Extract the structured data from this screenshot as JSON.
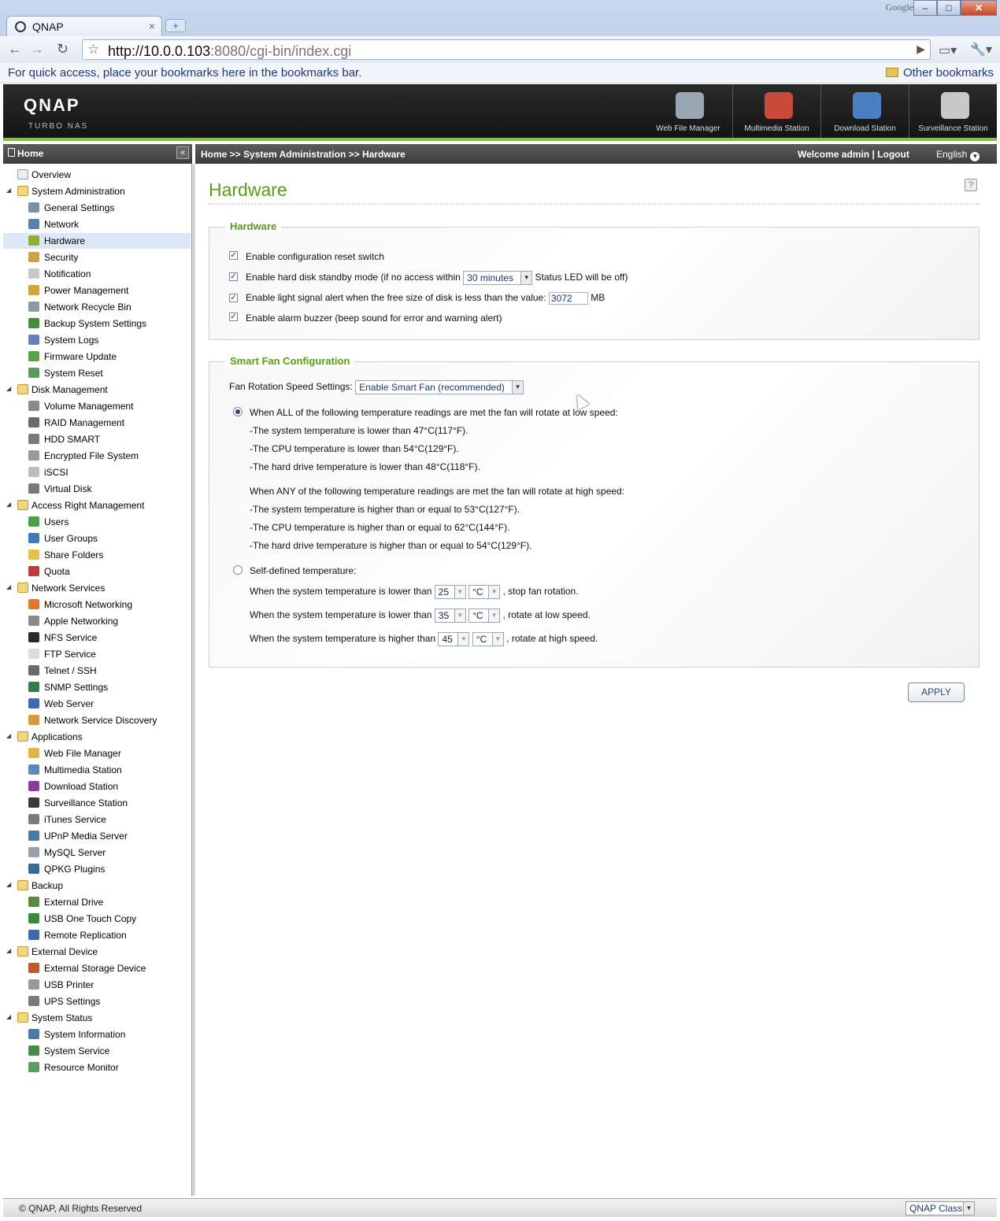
{
  "browser": {
    "tab_title": "QNAP",
    "tab_close": "×",
    "new_tab": "+",
    "url_host": "http://10.0.0.103",
    "url_rest": ":8080/cgi-bin/index.cgi",
    "google_label": "Google",
    "bookmarks_message": "For quick access, place your bookmarks here in the bookmarks bar.",
    "other_bookmarks": "Other bookmarks"
  },
  "header": {
    "brand": "QNAP",
    "brand_sub": "TURBO NAS",
    "apps": [
      {
        "label": "Web File Manager",
        "color": "#9aa7b3"
      },
      {
        "label": "Multimedia Station",
        "color": "#c94a3a"
      },
      {
        "label": "Download Station",
        "color": "#4a7fc1"
      },
      {
        "label": "Surveillance Station",
        "color": "#c8c8c8"
      }
    ]
  },
  "nav": {
    "home": "Home",
    "collapse": "«",
    "breadcrumb": "Home >> System Administration >> Hardware",
    "welcome": "Welcome admin | Logout",
    "language": "English"
  },
  "sidebar": {
    "items": [
      {
        "label": "Overview",
        "kind": "top",
        "icon": "overview-icon",
        "color": "#e8eef4"
      },
      {
        "label": "System Administration",
        "kind": "cat"
      },
      {
        "label": "General Settings",
        "kind": "sub",
        "icon": "general-settings-icon",
        "color": "#7c8fa3"
      },
      {
        "label": "Network",
        "kind": "sub",
        "icon": "network-icon",
        "color": "#5a7fa8"
      },
      {
        "label": "Hardware",
        "kind": "sub",
        "icon": "hardware-icon",
        "color": "#8fae2c",
        "active": true
      },
      {
        "label": "Security",
        "kind": "sub",
        "icon": "security-icon",
        "color": "#c9a34a"
      },
      {
        "label": "Notification",
        "kind": "sub",
        "icon": "notification-icon",
        "color": "#c7c7c7"
      },
      {
        "label": "Power Management",
        "kind": "sub",
        "icon": "power-icon",
        "color": "#d2a53a"
      },
      {
        "label": "Network Recycle Bin",
        "kind": "sub",
        "icon": "recycle-bin-icon",
        "color": "#8b9aa8"
      },
      {
        "label": "Backup System Settings",
        "kind": "sub",
        "icon": "backup-settings-icon",
        "color": "#4a8a3a"
      },
      {
        "label": "System Logs",
        "kind": "sub",
        "icon": "logs-icon",
        "color": "#6a7fb8"
      },
      {
        "label": "Firmware Update",
        "kind": "sub",
        "icon": "firmware-icon",
        "color": "#5aa04a"
      },
      {
        "label": "System Reset",
        "kind": "sub",
        "icon": "reset-icon",
        "color": "#5a9a5a"
      },
      {
        "label": "Disk Management",
        "kind": "cat"
      },
      {
        "label": "Volume Management",
        "kind": "sub",
        "icon": "volume-icon",
        "color": "#8a8a8a"
      },
      {
        "label": "RAID Management",
        "kind": "sub",
        "icon": "raid-icon",
        "color": "#6a6a6a"
      },
      {
        "label": "HDD SMART",
        "kind": "sub",
        "icon": "hdd-icon",
        "color": "#7a7a7a"
      },
      {
        "label": "Encrypted File System",
        "kind": "sub",
        "icon": "encrypt-icon",
        "color": "#9a9a9a"
      },
      {
        "label": "iSCSI",
        "kind": "sub",
        "icon": "iscsi-icon",
        "color": "#bdbdbd"
      },
      {
        "label": "Virtual Disk",
        "kind": "sub",
        "icon": "virtual-disk-icon",
        "color": "#7a7a7a"
      },
      {
        "label": "Access Right Management",
        "kind": "cat"
      },
      {
        "label": "Users",
        "kind": "sub",
        "icon": "user-icon",
        "color": "#4aa04a"
      },
      {
        "label": "User Groups",
        "kind": "sub",
        "icon": "user-groups-icon",
        "color": "#3a7ac0"
      },
      {
        "label": "Share Folders",
        "kind": "sub",
        "icon": "share-folder-icon",
        "color": "#e3c24a"
      },
      {
        "label": "Quota",
        "kind": "sub",
        "icon": "quota-icon",
        "color": "#c03a3a"
      },
      {
        "label": "Network Services",
        "kind": "cat"
      },
      {
        "label": "Microsoft Networking",
        "kind": "sub",
        "icon": "windows-icon",
        "color": "#e07a2a"
      },
      {
        "label": "Apple Networking",
        "kind": "sub",
        "icon": "apple-icon",
        "color": "#8a8a8a"
      },
      {
        "label": "NFS Service",
        "kind": "sub",
        "icon": "linux-icon",
        "color": "#2a2a2a"
      },
      {
        "label": "FTP Service",
        "kind": "sub",
        "icon": "ftp-icon",
        "color": "#dcdcdc"
      },
      {
        "label": "Telnet / SSH",
        "kind": "sub",
        "icon": "telnet-icon",
        "color": "#6a6a6a"
      },
      {
        "label": "SNMP Settings",
        "kind": "sub",
        "icon": "snmp-icon",
        "color": "#3a7a4a"
      },
      {
        "label": "Web Server",
        "kind": "sub",
        "icon": "web-server-icon",
        "color": "#3a6ab8"
      },
      {
        "label": "Network Service Discovery",
        "kind": "sub",
        "icon": "discovery-icon",
        "color": "#d89a3a"
      },
      {
        "label": "Applications",
        "kind": "cat"
      },
      {
        "label": "Web File Manager",
        "kind": "sub",
        "icon": "web-file-manager-icon",
        "color": "#e3b24a"
      },
      {
        "label": "Multimedia Station",
        "kind": "sub",
        "icon": "multimedia-icon",
        "color": "#5a8ac0"
      },
      {
        "label": "Download Station",
        "kind": "sub",
        "icon": "download-icon",
        "color": "#8a3aa0"
      },
      {
        "label": "Surveillance Station",
        "kind": "sub",
        "icon": "camera-icon",
        "color": "#3a3a3a"
      },
      {
        "label": "iTunes Service",
        "kind": "sub",
        "icon": "itunes-icon",
        "color": "#7a7a7a"
      },
      {
        "label": "UPnP Media Server",
        "kind": "sub",
        "icon": "upnp-icon",
        "color": "#4a7aa0"
      },
      {
        "label": "MySQL Server",
        "kind": "sub",
        "icon": "mysql-icon",
        "color": "#9aa0a8"
      },
      {
        "label": "QPKG Plugins",
        "kind": "sub",
        "icon": "qpkg-icon",
        "color": "#3a6a9a"
      },
      {
        "label": "Backup",
        "kind": "cat"
      },
      {
        "label": "External Drive",
        "kind": "sub",
        "icon": "external-drive-icon",
        "color": "#5a8a3a"
      },
      {
        "label": "USB One Touch Copy",
        "kind": "sub",
        "icon": "usb-copy-icon",
        "color": "#3a8a3a"
      },
      {
        "label": "Remote Replication",
        "kind": "sub",
        "icon": "replication-icon",
        "color": "#3a6ab8"
      },
      {
        "label": "External Device",
        "kind": "cat"
      },
      {
        "label": "External Storage Device",
        "kind": "sub",
        "icon": "storage-device-icon",
        "color": "#c05a2a"
      },
      {
        "label": "USB Printer",
        "kind": "sub",
        "icon": "printer-icon",
        "color": "#9a9a9a"
      },
      {
        "label": "UPS Settings",
        "kind": "sub",
        "icon": "ups-icon",
        "color": "#7a7a7a"
      },
      {
        "label": "System Status",
        "kind": "cat"
      },
      {
        "label": "System Information",
        "kind": "sub",
        "icon": "system-info-icon",
        "color": "#4a7aa8"
      },
      {
        "label": "System Service",
        "kind": "sub",
        "icon": "system-service-icon",
        "color": "#4a8a4a"
      },
      {
        "label": "Resource Monitor",
        "kind": "sub",
        "icon": "resource-monitor-icon",
        "color": "#5aa05a"
      }
    ]
  },
  "main": {
    "title": "Hardware",
    "help": "?",
    "hardware": {
      "legend": "Hardware",
      "reset_switch": "Enable configuration reset switch",
      "standby_prefix": "Enable hard disk standby mode (if no access within",
      "standby_value": "30 minutes",
      "standby_suffix": "Status LED will be off)",
      "light_alert_prefix": "Enable light signal alert when the free size of disk is less than the value:",
      "light_alert_value": "3072",
      "light_alert_unit": "MB",
      "buzzer": "Enable alarm buzzer (beep sound for error and warning alert)"
    },
    "fan": {
      "legend": "Smart Fan Configuration",
      "speed_label": "Fan Rotation Speed Settings:",
      "speed_value": "Enable Smart Fan (recommended)",
      "all_rule": "When ALL of the following temperature readings are met the fan will rotate at low speed:",
      "low_1": "-The system temperature is lower than 47°C(117°F).",
      "low_2": "-The CPU temperature is lower than 54°C(129°F).",
      "low_3": "-The hard drive temperature is lower than 48°C(118°F).",
      "any_rule": "When ANY of the following temperature readings are met the fan will rotate at high speed:",
      "high_1": "-The system temperature is higher than or equal to 53°C(127°F).",
      "high_2": "-The CPU temperature is higher than or equal to 62°C(144°F).",
      "high_3": "-The hard drive temperature is higher than or equal to 54°C(129°F).",
      "self_defined": "Self-defined temperature:",
      "stop_prefix": "When the system temperature is lower than",
      "stop_value": "25",
      "stop_unit": "°C",
      "stop_suffix": ", stop fan rotation.",
      "low_prefix": "When the system temperature is lower than",
      "low_value": "35",
      "low_unit": "°C",
      "low_suffix": ", rotate at low speed.",
      "high_prefix": "When the system temperature is higher than",
      "high_value": "45",
      "high_unit": "°C",
      "high_suffix": ", rotate at high speed."
    },
    "apply": "APPLY"
  },
  "footer": {
    "copyright": "© QNAP, All Rights Reserved",
    "theme": "QNAP Classic"
  }
}
